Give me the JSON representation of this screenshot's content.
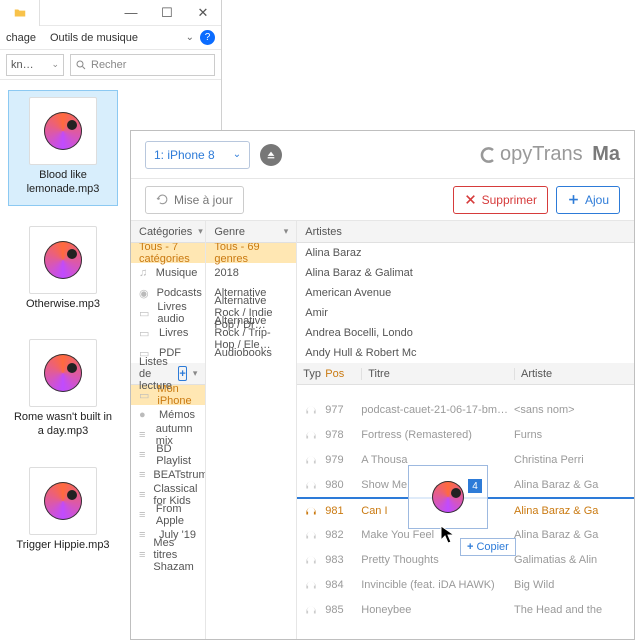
{
  "explorer": {
    "ribbon_affichage": "chage",
    "ribbon_outils": "Outils de musique",
    "path_fragment": "kn…",
    "search_placeholder": "Recher",
    "files": [
      {
        "name": "Blood like lemonade.mp3",
        "selected": true
      },
      {
        "name": "Otherwise.mp3",
        "selected": false
      },
      {
        "name": "Rome wasn't built in a day.mp3",
        "selected": false
      },
      {
        "name": "Trigger Hippie.mp3",
        "selected": false
      }
    ]
  },
  "app": {
    "device": "1: iPhone 8",
    "brand_a": "opyTrans",
    "brand_b": "Ma",
    "refresh": "Mise à jour",
    "delete": "Supprimer",
    "add": "Ajou"
  },
  "categories": {
    "header": "Catégories",
    "all": "Tous - 7 catégories",
    "items": [
      "Musique",
      "Podcasts",
      "Livres audio",
      "Livres",
      "PDF"
    ]
  },
  "genres": {
    "header": "Genre",
    "all": "Tous - 69 genres",
    "items": [
      "2018",
      "Alternative",
      "Alternative Rock / Indie Pop / Dr…",
      "Alternative Rock / Trip-Hop / Ele…",
      "Audiobooks"
    ]
  },
  "artists": {
    "header": "Artistes",
    "items": [
      "Alina Baraz",
      "Alina Baraz & Galimat",
      "American Avenue",
      "Amir",
      "Andrea Bocelli, Londo",
      "Andy Hull & Robert Mc"
    ]
  },
  "playlists": {
    "header": "Listes de lecture",
    "items": [
      {
        "label": "Mon iPhone",
        "icon": "phone",
        "sel": true
      },
      {
        "label": "Mémos",
        "icon": "mic"
      },
      {
        "label": "autumn mix",
        "icon": "list"
      },
      {
        "label": "BD Playlist",
        "icon": "list"
      },
      {
        "label": "BEATstrumentals",
        "icon": "list"
      },
      {
        "label": "Classical for Kids",
        "icon": "list"
      },
      {
        "label": "From Apple",
        "icon": "list"
      },
      {
        "label": "July '19",
        "icon": "list"
      },
      {
        "label": "Mes titres Shazam",
        "icon": "list"
      }
    ]
  },
  "track_head": {
    "typ": "Typ",
    "pos": "Pos",
    "titre": "Titre",
    "artiste": "Artiste"
  },
  "tracks": [
    {
      "pos": "977",
      "titre": "podcast-cauet-21-06-17-bm…",
      "artiste": "<sans nom>"
    },
    {
      "pos": "978",
      "titre": "Fortress (Remastered)",
      "artiste": "Furns"
    },
    {
      "pos": "979",
      "titre": "A Thousa",
      "artiste": "Christina Perri"
    },
    {
      "pos": "980",
      "titre": "Show Me",
      "artiste": "Alina Baraz & Ga"
    },
    {
      "pos": "981",
      "titre": "Can I",
      "artiste": "Alina Baraz & Ga",
      "active": true
    },
    {
      "pos": "982",
      "titre": "Make You Feel",
      "artiste": "Alina Baraz & Ga"
    },
    {
      "pos": "983",
      "titre": "Pretty Thoughts",
      "artiste": "Galimatias & Alin"
    },
    {
      "pos": "984",
      "titre": "Invincible (feat. iDA HAWK)",
      "artiste": "Big Wild"
    },
    {
      "pos": "985",
      "titre": "Honeybee",
      "artiste": "The Head and the"
    }
  ],
  "drag": {
    "count": "4",
    "copy": "Copier"
  }
}
